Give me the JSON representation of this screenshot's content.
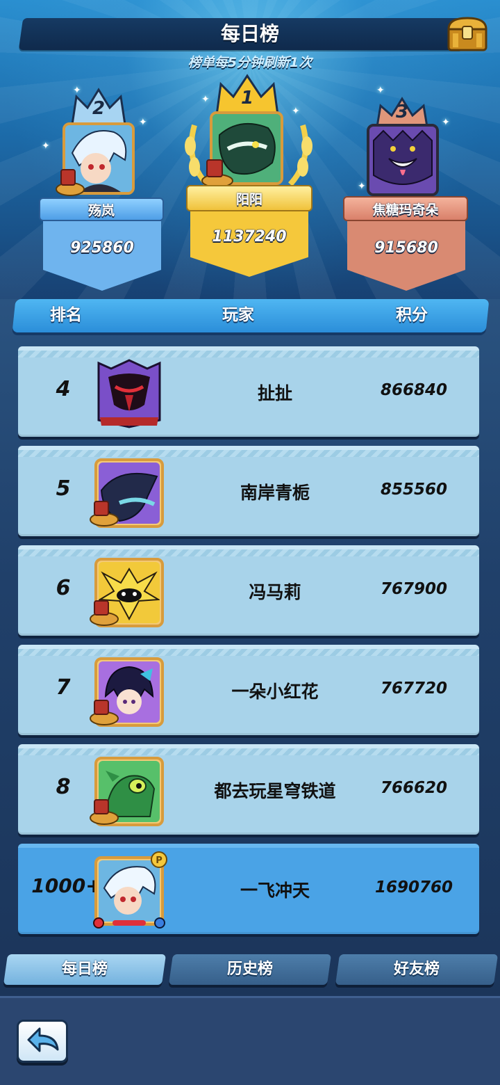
{
  "header": {
    "title": "每日榜",
    "subtitle": "榜单每5分钟刷新1次",
    "chest_icon": "treasure-chest-icon"
  },
  "podium": [
    {
      "rank": "2",
      "name": "殇岚",
      "score": "925860",
      "color": "#6fb4ee"
    },
    {
      "rank": "1",
      "name": "阳阳",
      "score": "1137240",
      "color": "#f5c83b"
    },
    {
      "rank": "3",
      "name": "焦糖玛奇朵",
      "score": "915680",
      "color": "#d98a72"
    }
  ],
  "table_header": {
    "rank": "排名",
    "player": "玩家",
    "score": "积分"
  },
  "rows": [
    {
      "rank": "4",
      "name": "扯扯",
      "score": "866840"
    },
    {
      "rank": "5",
      "name": "南岸青栀",
      "score": "855560"
    },
    {
      "rank": "6",
      "name": "冯马莉",
      "score": "767900"
    },
    {
      "rank": "7",
      "name": "一朵小红花",
      "score": "767720"
    },
    {
      "rank": "8",
      "name": "都去玩星穹铁道",
      "score": "766620"
    }
  ],
  "self_row": {
    "rank": "1000+",
    "name": "一飞冲天",
    "score": "1690760"
  },
  "tabs": {
    "daily": "每日榜",
    "history": "历史榜",
    "friends": "好友榜"
  },
  "colors": {
    "accent": "#2b8ed9",
    "row_bg": "#a8d3ea",
    "self_row_bg": "#4aa3e6",
    "gold": "#f5c83b"
  },
  "footer": {
    "back_icon": "back-arrow-icon"
  }
}
